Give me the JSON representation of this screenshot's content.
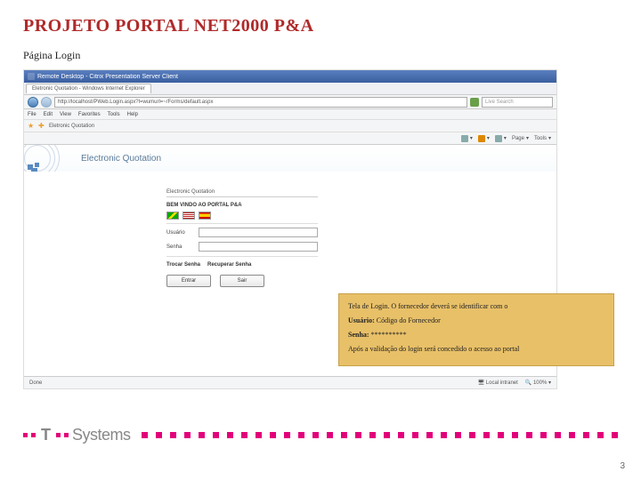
{
  "slide": {
    "title": "PROJETO PORTAL NET2000 P&A",
    "subtitle": "Página Login",
    "page_number": "3"
  },
  "browser": {
    "window_title": "Remote Desktop - Citrix Presentation Server Client",
    "tab_title": "Eletronic Quotation - Windows Internet Explorer",
    "url": "http://localhost/PWeb.Login.aspx?l=wumurl=~/Forms/default.aspx",
    "search_placeholder": "Live Search",
    "menu": {
      "file": "File",
      "edit": "Edit",
      "view": "View",
      "favorites": "Favorites",
      "tools": "Tools",
      "help": "Help"
    },
    "fav_item": "Eletronic Quotation",
    "toolbar": {
      "home": "",
      "feeds": "",
      "print": "",
      "page": "Page",
      "tools": "Tools"
    },
    "page_title": "Electronic Quotation",
    "status_left": "Done",
    "status_zone": "Local intranet",
    "status_zoom": "100%"
  },
  "login": {
    "box_title": "Electronic Quotation",
    "welcome": "BEM VINDO AO PORTAL P&A",
    "user_label": "Usuário",
    "pass_label": "Senha",
    "link_change": "Trocar Senha",
    "link_recover": "Recuperar Senha",
    "btn_enter": "Entrar",
    "btn_exit": "Sair"
  },
  "callout": {
    "line1": "Tela de Login. O fornecedor deverá se identificar com o",
    "line2a": "Usuário:",
    "line2b": "Código do Fornecedor",
    "line3a": "Senha:",
    "line3b": "**********",
    "line4": "Após a validação do login será concedido o acesso ao portal"
  },
  "footer": {
    "brand": "Systems"
  }
}
